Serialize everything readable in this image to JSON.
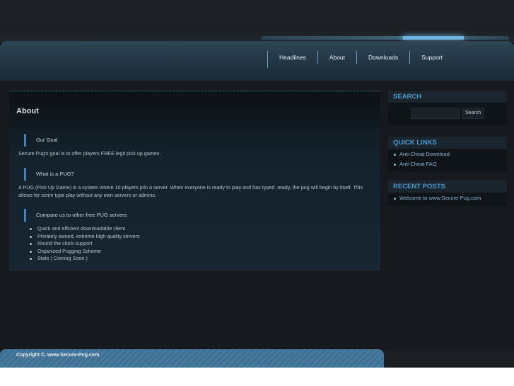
{
  "nav": {
    "items": [
      {
        "label": "Headlines"
      },
      {
        "label": "About"
      },
      {
        "label": "Downloads"
      },
      {
        "label": "Support"
      }
    ]
  },
  "main": {
    "title": "About",
    "sections": [
      {
        "heading": "Our Goal",
        "text": "Secure Pug's goal is to offer players FREE legit pick up games."
      },
      {
        "heading": "What is a PUG?",
        "text": "A PUG (Pick Up Game) is a system where 10 players join a server. When everyone is ready to play and has typed .ready, the pug will begin by itself. This allows for scrim type play without any own servers or admins."
      },
      {
        "heading": "Compare us to other free PUG servers",
        "bullets": [
          "Quick and efficient downloadable client",
          "Privately owned, extreme high quality servers",
          "Round the clock support",
          "Organized Pugging Scheme",
          "Stats ( Coming Soon )"
        ]
      }
    ]
  },
  "sidebar": {
    "search": {
      "title": "SEARCH",
      "button_label": "Search",
      "value": ""
    },
    "quick_links": {
      "title": "QUICK LINKS",
      "items": [
        "Anti-Cheat Download",
        "Anti-Cheat FAQ"
      ]
    },
    "recent_posts": {
      "title": "RECENT POSTS",
      "items": [
        "Welcome to www.Secure-Pug.com"
      ]
    }
  },
  "footer": {
    "copyright": "Copyright ©. www.Secure-Pug.com."
  },
  "colors": {
    "accent": "#4b9acf",
    "footer": "#3f6f92",
    "background": "#15191d"
  }
}
